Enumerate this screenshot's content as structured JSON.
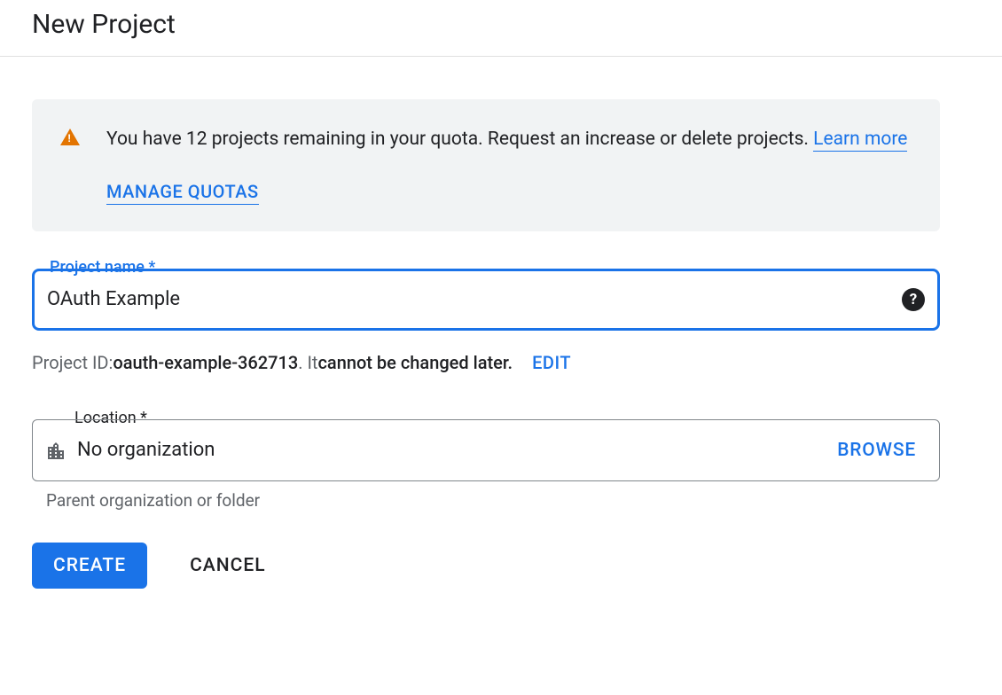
{
  "header": {
    "title": "New Project"
  },
  "quota": {
    "message": "You have 12 projects remaining in your quota. Request an increase or delete projects. ",
    "learn_more": "Learn more",
    "manage_quotas": "MANAGE QUOTAS"
  },
  "project_name": {
    "label": "Project name *",
    "value": "OAuth Example"
  },
  "project_id": {
    "prefix": "Project ID: ",
    "value": "oauth-example-362713",
    "suffix": ". It ",
    "bold_suffix": "cannot be changed later.",
    "edit": "EDIT"
  },
  "location": {
    "label": "Location *",
    "value": "No organization",
    "browse": "BROWSE",
    "hint": "Parent organization or folder"
  },
  "buttons": {
    "create": "CREATE",
    "cancel": "CANCEL"
  }
}
